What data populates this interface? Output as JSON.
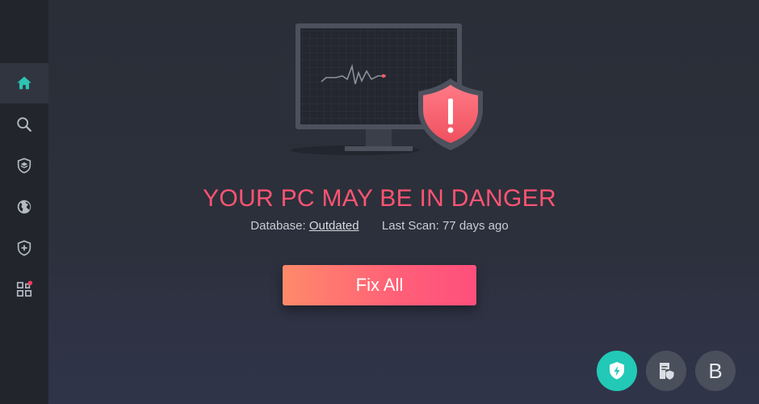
{
  "sidebar": {
    "items": [
      {
        "icon": "home-icon",
        "active": true
      },
      {
        "icon": "search-icon",
        "active": false
      },
      {
        "icon": "shield-layers-icon",
        "active": false
      },
      {
        "icon": "globe-icon",
        "active": false
      },
      {
        "icon": "shield-plus-icon",
        "active": false
      },
      {
        "icon": "apps-grid-icon",
        "active": false,
        "notification": true
      }
    ]
  },
  "status": {
    "title": "YOUR PC MAY BE IN DANGER",
    "database_label": "Database:",
    "database_value": "Outdated",
    "last_scan_label": "Last Scan:",
    "last_scan_value": "77 days ago"
  },
  "actions": {
    "fix_all_label": "Fix All"
  },
  "bottom_buttons": {
    "protect_icon": "shield-bolt-icon",
    "report_icon": "document-shield-icon",
    "browser_letter": "B"
  },
  "colors": {
    "accent_danger": "#ff5473",
    "accent_teal": "#22c9b6",
    "sidebar_icon": "#b6bac3",
    "active_icon": "#2ec4b3"
  }
}
